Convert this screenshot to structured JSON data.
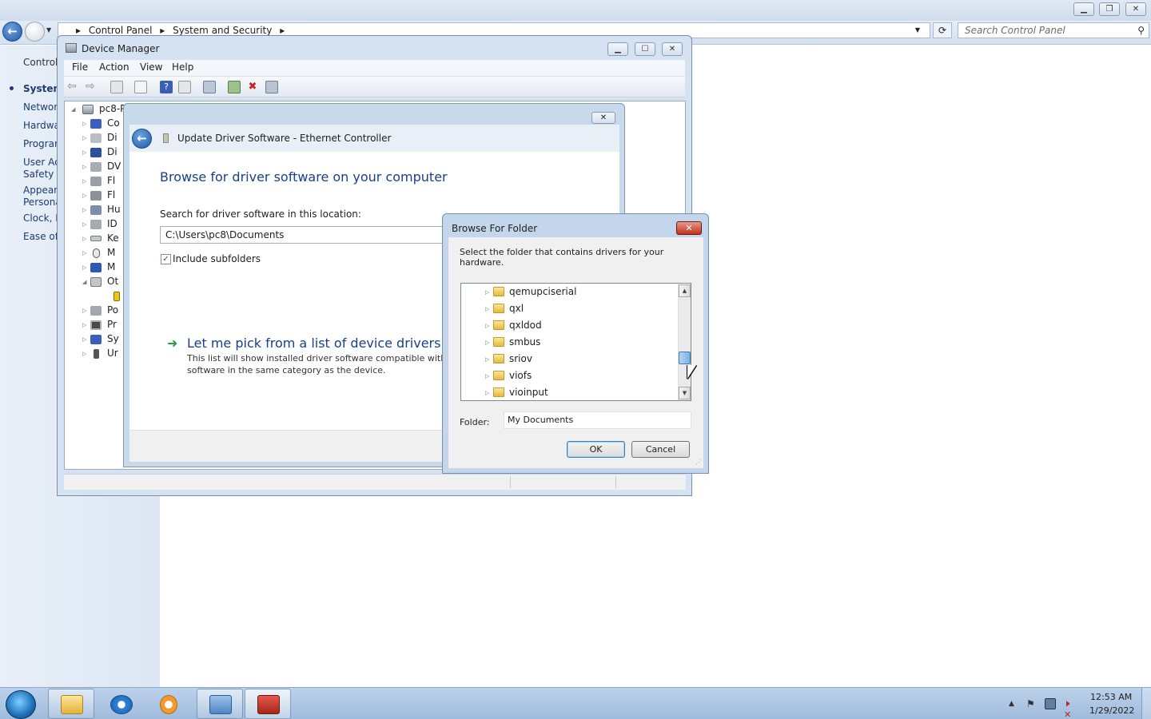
{
  "control_panel": {
    "breadcrumb": [
      "Control Panel",
      "System and Security"
    ],
    "search_placeholder": "Search Control Panel",
    "left_nav": [
      "Control",
      "System",
      "Network",
      "Hardwa",
      "Program",
      "User Acc",
      "Safety",
      "Appeara",
      "Persona",
      "Clock, L",
      "Ease of A"
    ]
  },
  "device_manager": {
    "title": "Device Manager",
    "menu": [
      "File",
      "Action",
      "View",
      "Help"
    ],
    "tree_root": "pc8-P",
    "tree_items": [
      "Co",
      "Di",
      "Di",
      "DV",
      "Fl",
      "Fl",
      "Hu",
      "ID",
      "Ke",
      "M",
      "M",
      "Ot",
      "",
      "Po",
      "Pr",
      "Sy",
      "Ur"
    ]
  },
  "update_driver": {
    "title": "Update Driver Software - Ethernet Controller",
    "heading": "Browse for driver software on your computer",
    "search_label": "Search for driver software in this location:",
    "path": "C:\\Users\\pc8\\Documents",
    "include_subfolders_label": "Include subfolders",
    "include_subfolders_checked": "✓",
    "pick_link": "Let me pick from a list of device drivers on my",
    "pick_desc_1": "This list will show installed driver software compatible with th",
    "pick_desc_2": "software in the same category as the device."
  },
  "browse_folder": {
    "title": "Browse For Folder",
    "instruction": "Select the folder that contains drivers for your hardware.",
    "folders": [
      "qemupciserial",
      "qxl",
      "qxldod",
      "smbus",
      "sriov",
      "viofs",
      "vioinput"
    ],
    "folder_label": "Folder:",
    "folder_value": "My Documents",
    "ok_label": "OK",
    "cancel_label": "Cancel",
    "scroll_position": 0.7
  },
  "taskbar": {
    "time": "12:53 AM",
    "date": "1/29/2022"
  },
  "colors": {
    "accent_blue": "#1a3e8c",
    "close_red": "#c2301a",
    "folder_yellow": "#e7b93c"
  }
}
